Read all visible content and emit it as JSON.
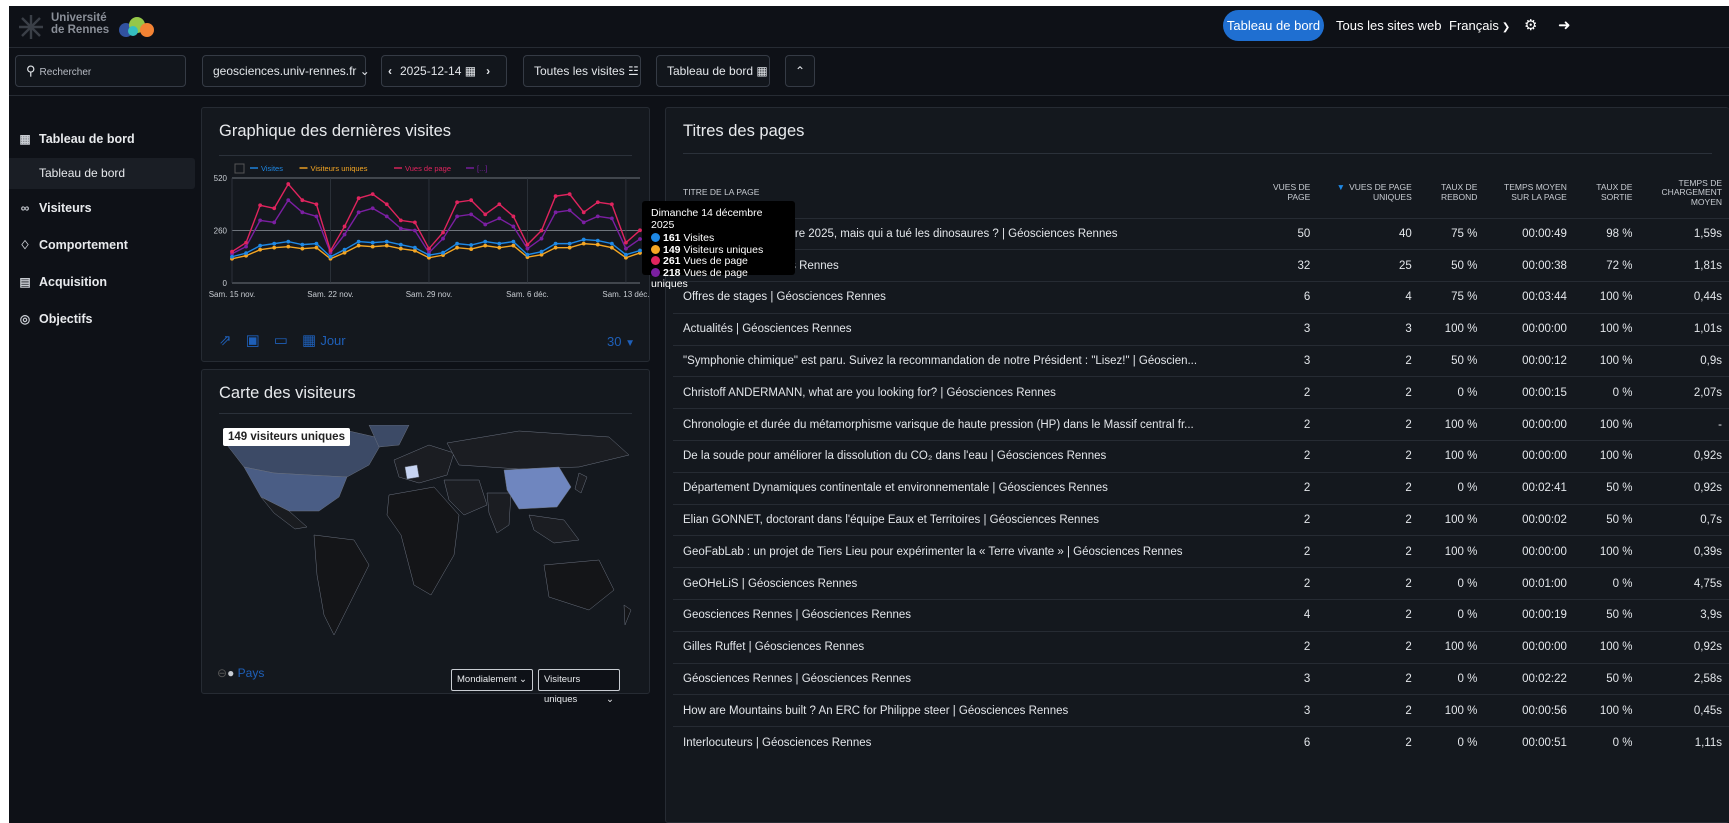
{
  "header": {
    "logo_line1": "Université",
    "logo_line2": "de Rennes",
    "nav_dashboard": "Tableau de bord",
    "nav_all_sites": "Tous les sites web",
    "nav_language": "Français"
  },
  "toolbar": {
    "search_placeholder": "Rechercher",
    "site": "geosciences.univ-rennes.fr",
    "date": "2025-12-14",
    "segment": "Toutes les visites",
    "dashboard": "Tableau de bord"
  },
  "sidebar": {
    "dashboard": "Tableau de bord",
    "dashboard_sub": "Tableau de bord",
    "visitors": "Visiteurs",
    "behaviour": "Comportement",
    "acquisition": "Acquisition",
    "goals": "Objectifs"
  },
  "visits_card": {
    "title": "Graphique des dernières visites",
    "period_label": "Jour",
    "limit": "30"
  },
  "chart_data": {
    "type": "line",
    "ylim": [
      0,
      520
    ],
    "yticks": [
      "0",
      "260",
      "520"
    ],
    "xticks": [
      "Sam. 15 nov.",
      "Sam. 22 nov.",
      "Sam. 29 nov.",
      "Sam. 6 déc.",
      "Sam. 13 déc."
    ],
    "x": [
      "15 nov.",
      "16 nov.",
      "17 nov.",
      "18 nov.",
      "19 nov.",
      "20 nov.",
      "21 nov.",
      "22 nov.",
      "23 nov.",
      "24 nov.",
      "25 nov.",
      "26 nov.",
      "27 nov.",
      "28 nov.",
      "29 nov.",
      "30 nov.",
      "1 déc.",
      "2 déc.",
      "3 déc.",
      "4 déc.",
      "5 déc.",
      "6 déc.",
      "7 déc.",
      "8 déc.",
      "9 déc.",
      "10 déc.",
      "11 déc.",
      "12 déc.",
      "13 déc.",
      "14 déc."
    ],
    "series": [
      {
        "name": "Visites",
        "color": "#1e88e5",
        "values": [
          130,
          148,
          185,
          195,
          205,
          190,
          195,
          130,
          165,
          205,
          200,
          205,
          190,
          175,
          138,
          150,
          195,
          188,
          205,
          195,
          205,
          140,
          155,
          195,
          195,
          215,
          210,
          195,
          140,
          161
        ]
      },
      {
        "name": "Visiteurs uniques",
        "color": "#f5a623",
        "values": [
          120,
          135,
          165,
          175,
          180,
          170,
          175,
          120,
          150,
          185,
          180,
          185,
          170,
          160,
          125,
          138,
          175,
          168,
          185,
          175,
          185,
          128,
          140,
          175,
          175,
          195,
          190,
          175,
          125,
          149
        ]
      },
      {
        "name": "Vues de page",
        "color": "#e0245e",
        "values": [
          155,
          200,
          385,
          370,
          490,
          410,
          390,
          160,
          280,
          420,
          440,
          390,
          310,
          300,
          170,
          250,
          400,
          410,
          340,
          390,
          330,
          190,
          260,
          430,
          440,
          350,
          400,
          390,
          200,
          261
        ]
      },
      {
        "name": "[...]",
        "color": "#7b1fa2",
        "values": [
          145,
          180,
          310,
          300,
          410,
          350,
          330,
          150,
          240,
          350,
          370,
          330,
          270,
          260,
          150,
          220,
          330,
          340,
          290,
          320,
          280,
          170,
          220,
          350,
          360,
          300,
          330,
          320,
          170,
          218
        ]
      }
    ]
  },
  "tooltip": {
    "title": "Dimanche 14 décembre 2025",
    "visits": "161",
    "visits_label": "Visites",
    "uniques": "149",
    "uniques_label": "Visiteurs uniques",
    "pageviews": "261",
    "pageviews_label": "Vues de page",
    "unique_pageviews": "218",
    "unique_pageviews_label": "Vues de page uniques"
  },
  "map_card": {
    "title": "Carte des visiteurs",
    "tooltip": "149 visiteurs uniques",
    "country_link": "Pays",
    "scope_select": "Mondialement",
    "metric_select": "Visiteurs uniques"
  },
  "pages_card": {
    "title": "Titres des pages",
    "columns": [
      "TITRE DE LA PAGE",
      "VUES DE PAGE",
      "VUES DE PAGE UNIQUES",
      "TAUX DE REBOND",
      "TEMPS MOYEN SUR LA PAGE",
      "TAUX DE SORTIE",
      "TEMPS DE CHARGEMENT MOYEN"
    ],
    "rows": [
      [
        "Dimanche 14 décembre 2025, mais qui a tué les dinosaures ? | Géosciences Rennes",
        "50",
        "40",
        "75 %",
        "00:00:49",
        "98 %",
        "1,59s"
      ],
      [
        "Accueil | Géosciences Rennes",
        "32",
        "25",
        "50 %",
        "00:00:38",
        "72 %",
        "1,81s"
      ],
      [
        "Offres de stages | Géosciences Rennes",
        "6",
        "4",
        "75 %",
        "00:03:44",
        "100 %",
        "0,44s"
      ],
      [
        "Actualités | Géosciences Rennes",
        "3",
        "3",
        "100 %",
        "00:00:00",
        "100 %",
        "1,01s"
      ],
      [
        "\"Symphonie chimique\" est paru. Suivez la recommandation de notre Président : \"Lisez!\" | Géoscien...",
        "3",
        "2",
        "50 %",
        "00:00:12",
        "100 %",
        "0,9s"
      ],
      [
        "Christoff ANDERMANN, what are you looking for? | Géosciences Rennes",
        "2",
        "2",
        "0 %",
        "00:00:15",
        "0 %",
        "2,07s"
      ],
      [
        "Chronologie et durée du métamorphisme varisque de haute pression (HP) dans le Massif central fr...",
        "2",
        "2",
        "100 %",
        "00:00:00",
        "100 %",
        "-"
      ],
      [
        "De la soude pour améliorer la dissolution du CO₂ dans l'eau | Géosciences Rennes",
        "2",
        "2",
        "100 %",
        "00:00:00",
        "100 %",
        "0,92s"
      ],
      [
        "Département Dynamiques continentale et environnementale | Géosciences Rennes",
        "2",
        "2",
        "0 %",
        "00:02:41",
        "50 %",
        "0,92s"
      ],
      [
        "Elian GONNET, doctorant dans l'équipe Eaux et Territoires | Géosciences Rennes",
        "2",
        "2",
        "100 %",
        "00:00:02",
        "50 %",
        "0,7s"
      ],
      [
        "GeoFabLab : un projet de Tiers Lieu pour expérimenter la « Terre vivante » | Géosciences Rennes",
        "2",
        "2",
        "100 %",
        "00:00:00",
        "100 %",
        "0,39s"
      ],
      [
        "GeOHeLiS  | Géosciences Rennes",
        "2",
        "2",
        "0 %",
        "00:01:00",
        "0 %",
        "4,75s"
      ],
      [
        "Geosciences Rennes | Géosciences Rennes",
        "4",
        "2",
        "0 %",
        "00:00:19",
        "50 %",
        "3,9s"
      ],
      [
        "Gilles Ruffet | Géosciences Rennes",
        "2",
        "2",
        "100 %",
        "00:00:00",
        "100 %",
        "0,92s"
      ],
      [
        "Géosciences Rennes | Géosciences Rennes",
        "3",
        "2",
        "0 %",
        "00:02:22",
        "50 %",
        "2,58s"
      ],
      [
        "How are Mountains built ? An ERC for Philippe steer | Géosciences Rennes",
        "3",
        "2",
        "100 %",
        "00:00:56",
        "100 %",
        "0,45s"
      ],
      [
        "Interlocuteurs | Géosciences Rennes",
        "6",
        "2",
        "0 %",
        "00:00:51",
        "0 %",
        "1,11s"
      ]
    ]
  }
}
